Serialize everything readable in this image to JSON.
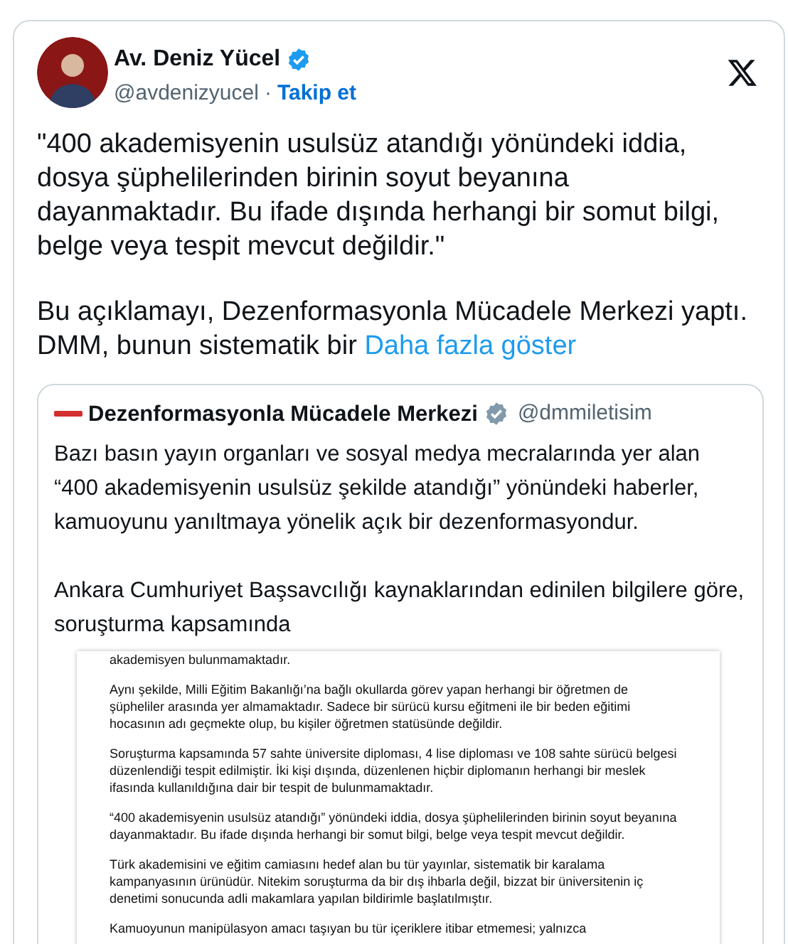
{
  "author": {
    "name": "Av. Deniz Yücel",
    "verified": true,
    "handle": "@avdenizyucel",
    "separator": "·",
    "follow": "Takip et"
  },
  "paragraphs": [
    "\"400 akademisyenin usulsüz atandığı yönündeki iddia, dosya şüphelilerinden birinin soyut beyanına dayanmaktadır. Bu ifade dışında herhangi bir somut bilgi, belge veya tespit mevcut değildir.\"",
    "Bu açıklamayı, Dezenformasyonla Mücadele Merkezi yaptı. DMM, bunun sistematik bir"
  ],
  "show_more": "Daha fazla göster",
  "quote": {
    "name": "Dezenformasyonla Mücadele Merkezi",
    "verified": true,
    "handle": "@dmmiletisim",
    "paragraphs": [
      "Bazı basın yayın organları ve sosyal medya mecralarında yer alan “400 akademisyenin usulsüz şekilde atandığı” yönündeki haberler, kamuoyunu yanıltmaya yönelik açık bir dezenformasyondur.",
      "Ankara Cumhuriyet Başsavcılığı kaynaklarından edinilen bilgilere göre, soruşturma kapsamında"
    ],
    "document": [
      "akademisyen bulunmamaktadır.",
      "Aynı şekilde, Milli Eğitim Bakanlığı’na bağlı okullarda görev yapan herhangi bir öğretmen de şüpheliler arasında yer almamaktadır. Sadece bir sürücü kursu eğitmeni ile bir beden eğitimi hocasının adı geçmekte olup, bu kişiler öğretmen statüsünde değildir.",
      "Soruşturma kapsamında 57 sahte üniversite diploması, 4 lise diploması ve 108 sahte sürücü belgesi düzenlendiği tespit edilmiştir. İki kişi dışında, düzenlenen hiçbir diplomanın herhangi bir meslek ifasında kullanıldığına dair bir tespit de bulunmamaktadır.",
      "“400 akademisyenin usulsüz atandığı” yönündeki iddia, dosya şüphelilerinden birinin soyut beyanına dayanmaktadır. Bu ifade dışında herhangi bir somut bilgi, belge veya tespit mevcut değildir.",
      "Türk akademisini ve eğitim camiasını hedef alan bu tür yayınlar, sistematik bir karalama kampanyasının ürünüdür. Nitekim soruşturma da bir dış ihbarla değil, bizzat bir üniversitenin iç denetimi sonucunda adli makamlara yapılan bildirimle başlatılmıştır.",
      "Kamuoyunun manipülasyon amacı taşıyan bu tür içeriklere itibar etmemesi; yalnızca"
    ]
  }
}
